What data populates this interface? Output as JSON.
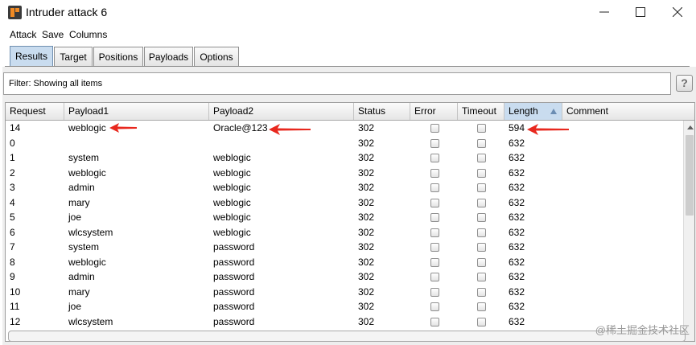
{
  "window": {
    "title": "Intruder attack 6",
    "controls": [
      "minimize",
      "maximize",
      "close"
    ]
  },
  "menu": [
    "Attack",
    "Save",
    "Columns"
  ],
  "tabs": [
    {
      "label": "Results",
      "active": true
    },
    {
      "label": "Target",
      "active": false
    },
    {
      "label": "Positions",
      "active": false
    },
    {
      "label": "Payloads",
      "active": false
    },
    {
      "label": "Options",
      "active": false
    }
  ],
  "filter": {
    "text": "Filter:  Showing all items",
    "help": "?"
  },
  "table": {
    "columns": [
      "Request",
      "Payload1",
      "Payload2",
      "Status",
      "Error",
      "Timeout",
      "Length",
      "Comment"
    ],
    "sorted_column": "Length",
    "rows": [
      {
        "request": "14",
        "payload1": "weblogic",
        "payload2": "Oracle@123",
        "status": "302",
        "length": "594"
      },
      {
        "request": "0",
        "payload1": "",
        "payload2": "",
        "status": "302",
        "length": "632"
      },
      {
        "request": "1",
        "payload1": "system",
        "payload2": "weblogic",
        "status": "302",
        "length": "632"
      },
      {
        "request": "2",
        "payload1": "weblogic",
        "payload2": "weblogic",
        "status": "302",
        "length": "632"
      },
      {
        "request": "3",
        "payload1": "admin",
        "payload2": "weblogic",
        "status": "302",
        "length": "632"
      },
      {
        "request": "4",
        "payload1": "mary",
        "payload2": "weblogic",
        "status": "302",
        "length": "632"
      },
      {
        "request": "5",
        "payload1": "joe",
        "payload2": "weblogic",
        "status": "302",
        "length": "632"
      },
      {
        "request": "6",
        "payload1": "wlcsystem",
        "payload2": "weblogic",
        "status": "302",
        "length": "632"
      },
      {
        "request": "7",
        "payload1": "system",
        "payload2": "password",
        "status": "302",
        "length": "632"
      },
      {
        "request": "8",
        "payload1": "weblogic",
        "payload2": "password",
        "status": "302",
        "length": "632"
      },
      {
        "request": "9",
        "payload1": "admin",
        "payload2": "password",
        "status": "302",
        "length": "632"
      },
      {
        "request": "10",
        "payload1": "mary",
        "payload2": "password",
        "status": "302",
        "length": "632"
      },
      {
        "request": "11",
        "payload1": "joe",
        "payload2": "password",
        "status": "302",
        "length": "632"
      },
      {
        "request": "12",
        "payload1": "wlcsystem",
        "payload2": "password",
        "status": "302",
        "length": "632"
      }
    ]
  },
  "annotation_color": "#e8281e",
  "watermark": "@稀土掘金技术社区"
}
